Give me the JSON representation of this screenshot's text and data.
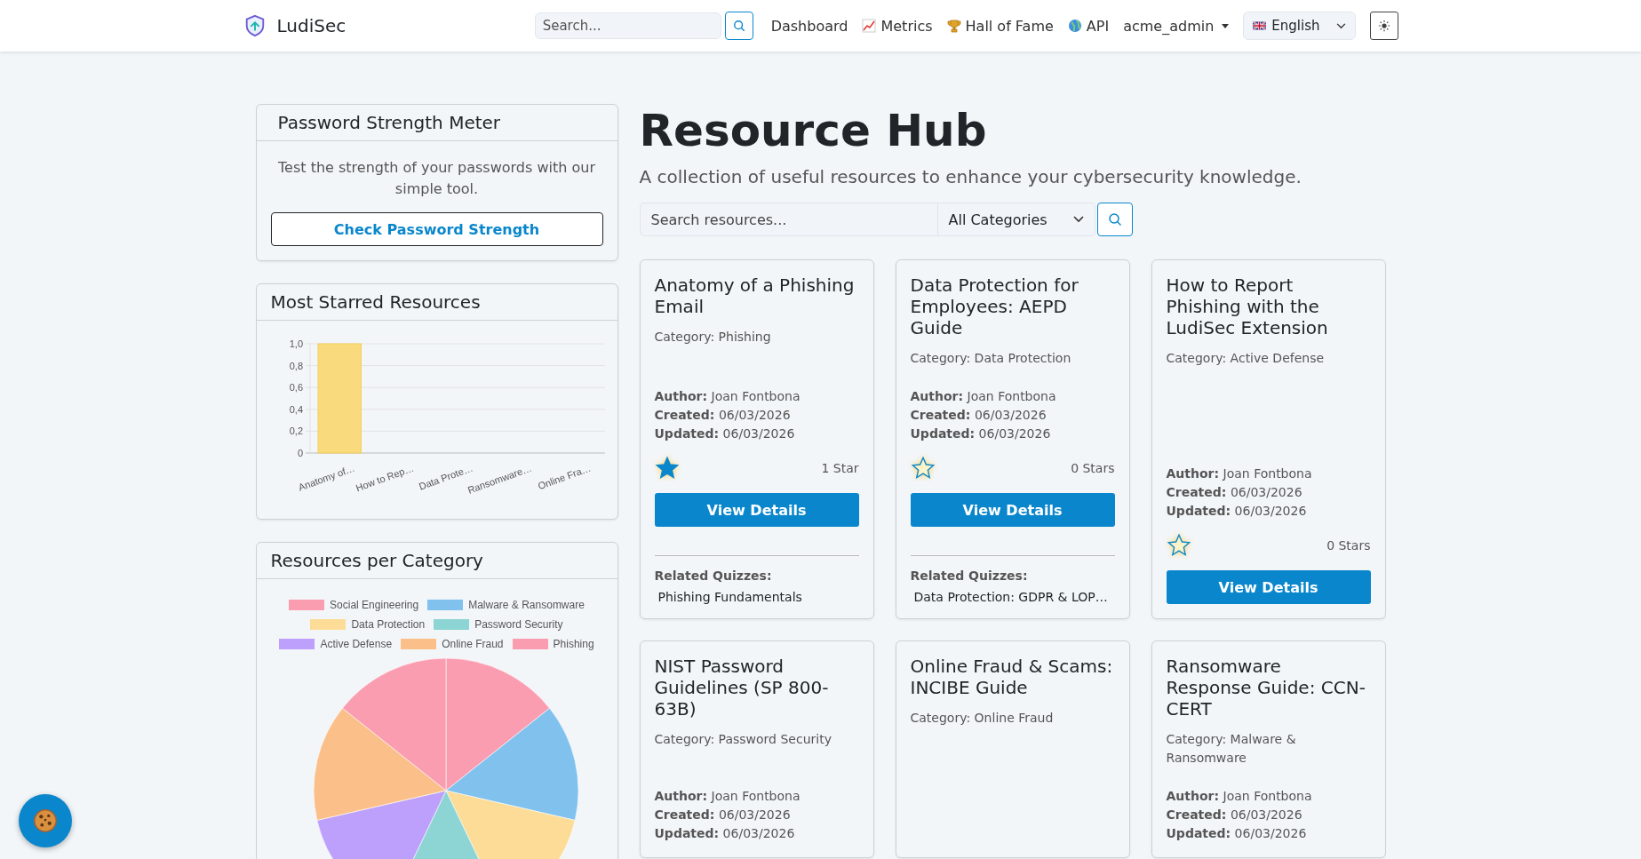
{
  "navbar": {
    "brand": "LudiSec",
    "search": {
      "placeholder": "Search..."
    },
    "links": [
      {
        "label": "Dashboard",
        "kind": "plain"
      },
      {
        "label": "Metrics",
        "kind": "chart"
      },
      {
        "label": "Hall of Fame",
        "kind": "trophy"
      },
      {
        "label": "API",
        "kind": "globe"
      }
    ],
    "user": "acme_admin",
    "language": "English"
  },
  "password_card": {
    "title": "Password Strength Meter",
    "text": "Test the strength of your passwords with our simple tool.",
    "button": "Check Password Strength"
  },
  "starred_card": {
    "title": "Most Starred Resources",
    "chart_data": {
      "type": "bar",
      "categories": [
        "Anatomy of…",
        "How to Rep…",
        "Data Prote…",
        "Ransomware…",
        "Online Fra…"
      ],
      "series": [
        {
          "color": "#f9da7c",
          "values": [
            1,
            0,
            0,
            0,
            0
          ]
        }
      ],
      "grid": true,
      "ylim": [
        0,
        1
      ],
      "yticks": [
        {
          "value": 0,
          "label": "0"
        },
        {
          "value": 0.2,
          "label": "0,2"
        },
        {
          "value": 0.4,
          "label": "0,4"
        },
        {
          "value": 0.6,
          "label": "0,6"
        },
        {
          "value": 0.8,
          "label": "0,8"
        },
        {
          "value": 1,
          "label": "1,0"
        }
      ]
    }
  },
  "category_card": {
    "title": "Resources per Category",
    "chart_data": {
      "type": "pie",
      "legend": "top",
      "categories": [
        "Social Engineering",
        "Malware & Ransomware",
        "Data Protection",
        "Password Security",
        "Active Defense",
        "Online Fraud",
        "Phishing"
      ],
      "values": [
        14.3,
        14.3,
        14.3,
        14.2,
        14.3,
        14.3,
        14.3
      ],
      "colors": [
        "#fb9db0",
        "#80c1ee",
        "#fcdc96",
        "#8dd5d4",
        "#bca0fb",
        "#fbc08a",
        "#fb9db0"
      ]
    }
  },
  "hub": {
    "title": "Resource Hub",
    "subtitle": "A collection of useful resources to enhance your cybersecurity knowledge.",
    "search": {
      "placeholder": "Search resources..."
    },
    "category_filter": "All Categories"
  },
  "resources": [
    {
      "title": "Anatomy of a Phishing Email",
      "category": "Category: Phishing",
      "meta": [
        "**Author:** Joan Fontbona",
        "**Created:** 06/03/2026",
        "**Updated:** 06/03/2026"
      ],
      "starred": true,
      "stars_label": "1 Star",
      "button": "View Details",
      "quizzes_label": "Related Quizzes:",
      "quizzes": [
        "Phishing Fundamentals"
      ]
    },
    {
      "title": "Data Protection for Employees: AEPD Guide",
      "category": "Category: Data Protection",
      "meta": [
        "**Author:** Joan Fontbona",
        "**Created:** 06/03/2026",
        "**Updated:** 06/03/2026"
      ],
      "starred": false,
      "stars_label": "0 Stars",
      "button": "View Details",
      "quizzes_label": "Related Quizzes:",
      "quizzes": [
        "Data Protection: GDPR & LOP…"
      ]
    },
    {
      "title": "How to Report Phishing with the LudiSec Extension",
      "category": "Category: Active Defense",
      "meta": [
        "**Author:** Joan Fontbona",
        "**Created:** 06/03/2026",
        "**Updated:** 06/03/2026"
      ],
      "starred": false,
      "stars_label": "0 Stars",
      "button": "View Details"
    },
    {
      "title": "NIST Password Guidelines (SP 800-63B)",
      "category": "Category: Password Security",
      "meta": [
        "**Author:** Joan Fontbona",
        "**Created:** 06/03/2026",
        "**Updated:** 06/03/2026"
      ]
    },
    {
      "title": "Online Fraud & Scams: INCIBE Guide",
      "category": "Category: Online Fraud"
    },
    {
      "title": "Ransomware Response Guide: CCN-CERT",
      "category": "Category: Malware & Ransomware",
      "meta": [
        "**Author:** Joan Fontbona",
        "**Created:** 06/03/2026",
        "**Updated:** 06/03/2026"
      ]
    }
  ]
}
